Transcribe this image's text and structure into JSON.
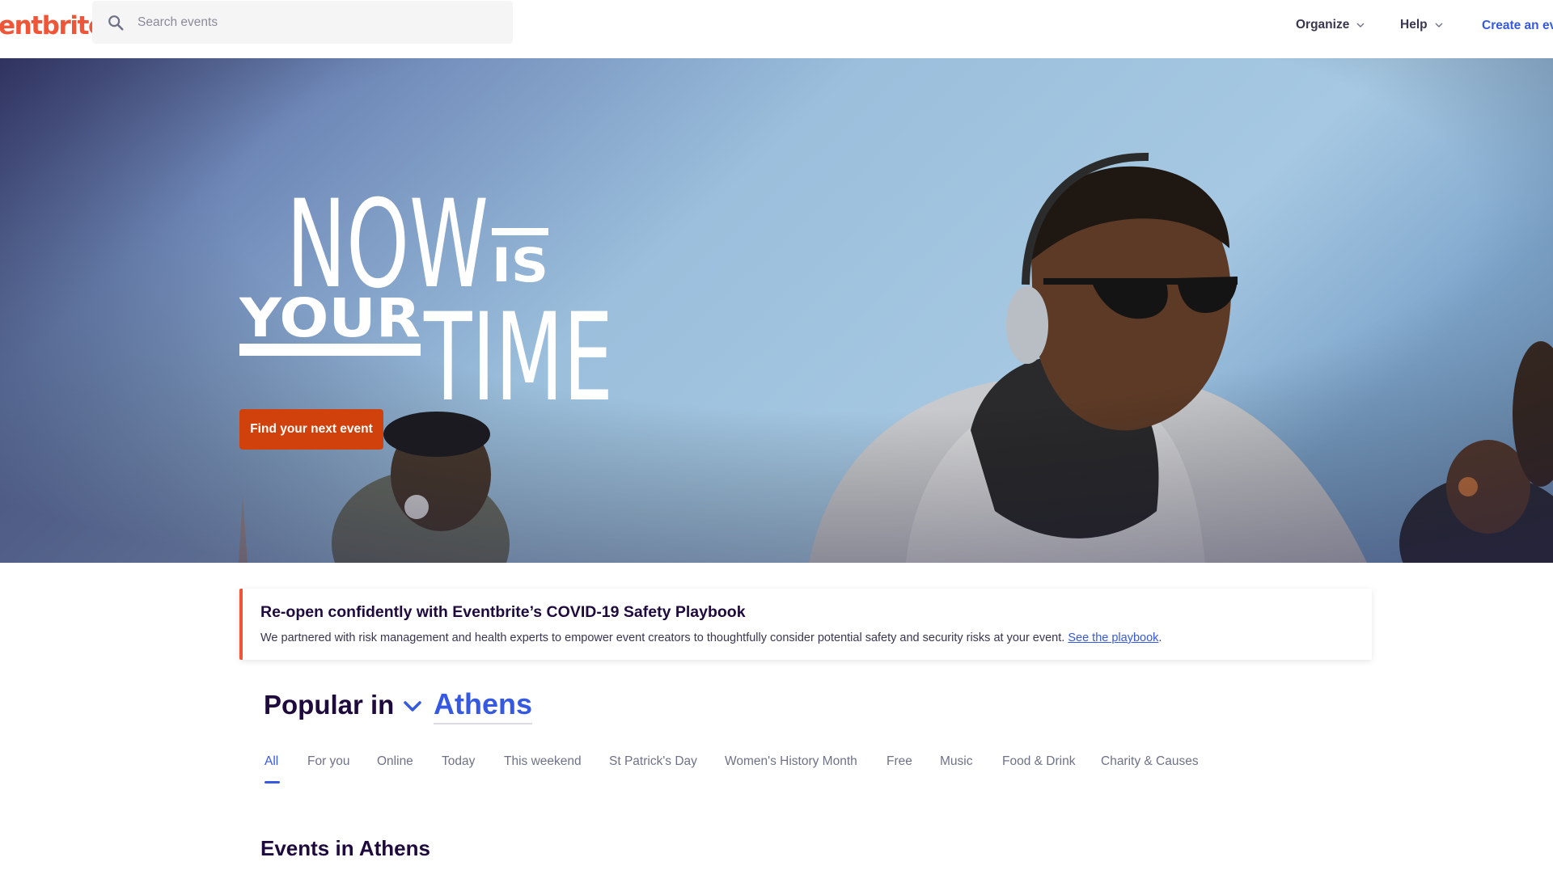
{
  "header": {
    "logo": "entbrite",
    "search_placeholder": "Search events",
    "nav": [
      {
        "label": "Organize"
      },
      {
        "label": "Help"
      }
    ],
    "create_label": "Create an eve"
  },
  "hero": {
    "headline_words": [
      "NOW",
      "IS",
      "YOUR",
      "TIME"
    ],
    "button_label": "Find your next event"
  },
  "banner": {
    "title": "Re-open confidently with Eventbrite’s COVID-19 Safety Playbook",
    "text": "We partnered with risk management and health experts to empower event creators to thoughtfully consider potential safety and security risks at your event. ",
    "link_label": "See the playbook",
    "suffix": ".",
    "accent_color": "#f05537"
  },
  "popular": {
    "label": "Popular in",
    "city": "Athens"
  },
  "tabs": [
    {
      "label": "All",
      "active": true
    },
    {
      "label": "For you"
    },
    {
      "label": "Online"
    },
    {
      "label": "Today"
    },
    {
      "label": "This weekend"
    },
    {
      "label": "St Patrick's Day"
    },
    {
      "label": "Women's History Month"
    },
    {
      "label": "Free"
    },
    {
      "label": "Music"
    },
    {
      "label": "Food & Drink"
    },
    {
      "label": "Charity & Causes"
    }
  ],
  "events_heading": "Events in Athens",
  "colors": {
    "brand": "#f05537",
    "link": "#3659e3",
    "cta": "#d1410c"
  }
}
